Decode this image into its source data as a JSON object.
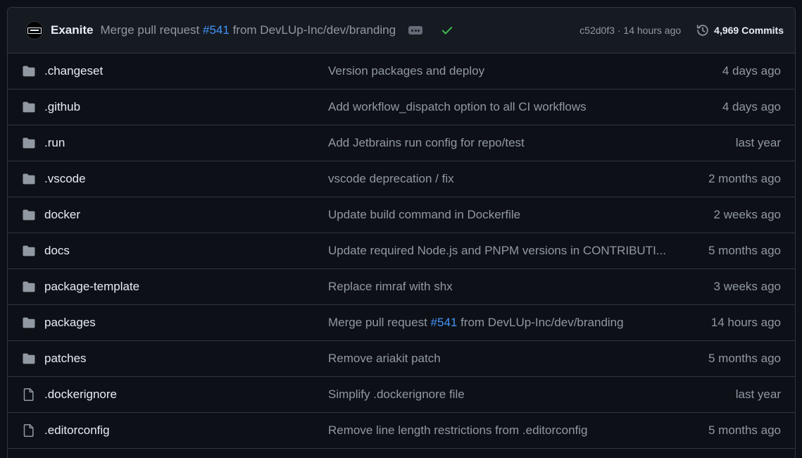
{
  "latest_commit": {
    "author": "Exanite",
    "message_prefix": "Merge pull request ",
    "pr_link": "#541",
    "message_suffix": " from DevLUp-Inc/dev/branding",
    "sha_time": "c52d0f3 · 14 hours ago",
    "commits_label": "4,969 Commits",
    "status": "success",
    "check_color": "#3fb950"
  },
  "files": [
    {
      "type": "folder",
      "name": ".changeset",
      "message": "Version packages and deploy",
      "age": "4 days ago"
    },
    {
      "type": "folder",
      "name": ".github",
      "message": "Add workflow_dispatch option to all CI workflows",
      "age": "4 days ago"
    },
    {
      "type": "folder",
      "name": ".run",
      "message": "Add Jetbrains run config for repo/test",
      "age": "last year"
    },
    {
      "type": "folder",
      "name": ".vscode",
      "message": "vscode deprecation / fix",
      "age": "2 months ago"
    },
    {
      "type": "folder",
      "name": "docker",
      "message": "Update build command in Dockerfile",
      "age": "2 weeks ago"
    },
    {
      "type": "folder",
      "name": "docs",
      "message": "Update required Node.js and PNPM versions in CONTRIBUTI...",
      "age": "5 months ago"
    },
    {
      "type": "folder",
      "name": "package-template",
      "message": "Replace rimraf with shx",
      "age": "3 weeks ago"
    },
    {
      "type": "folder",
      "name": "packages",
      "message_prefix": "Merge pull request ",
      "pr_link": "#541",
      "message_suffix": " from DevLUp-Inc/dev/branding",
      "age": "14 hours ago"
    },
    {
      "type": "folder",
      "name": "patches",
      "message": "Remove ariakit patch",
      "age": "5 months ago"
    },
    {
      "type": "file",
      "name": ".dockerignore",
      "message": "Simplify .dockerignore file",
      "age": "last year"
    },
    {
      "type": "file",
      "name": ".editorconfig",
      "message": "Remove line length restrictions from .editorconfig",
      "age": "5 months ago"
    }
  ]
}
